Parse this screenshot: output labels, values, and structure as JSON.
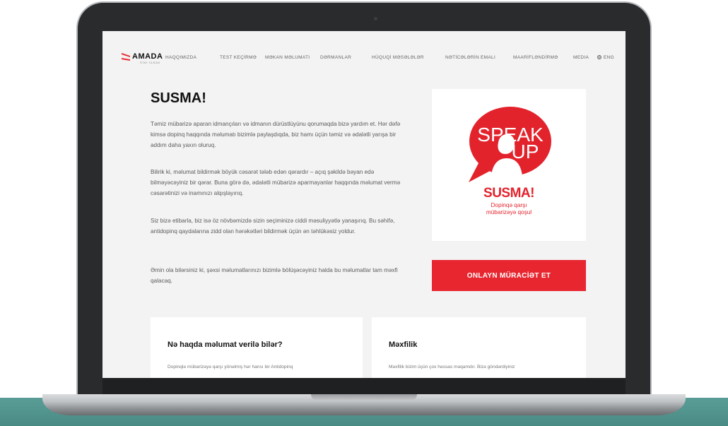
{
  "nav": {
    "logo_text": "AMADA",
    "logo_sub": "STAY CLEAN",
    "items": [
      {
        "label": "HAQQIMIZDA"
      },
      {
        "label": "TEST KEÇİRMƏ"
      },
      {
        "label": "MƏKAN MƏLUMATI"
      },
      {
        "label": "DƏRMANLAR"
      },
      {
        "label": "HÜQUQİ MƏSƏLƏLƏR"
      },
      {
        "label": "NƏTİCƏLƏRİN EMALI"
      },
      {
        "label": "MAARİFLƏNDİRMƏ"
      },
      {
        "label": "MEDIA"
      },
      {
        "label": "ENG"
      }
    ]
  },
  "hero": {
    "title": "SUSMA!",
    "paragraphs": [
      "Təmiz mübarizə aparan idmançıları və idmanın dürüstlüyünu qorumaqda bizə yardım et. Hər dəfə kimsə dopinq haqqında məlumatı bizimlə paylaşdıqda, biz hamı üçün təmiz və ədalətli yarışa bir addım daha yaxın oluruq.",
      "Bilirik ki, məlumat bildirmək böyük cəsarət tələb edən qərardır – açıq şəkildə bəyan edə bilməyəcəyiniz bir qərar. Buna görə də, ədalətli mübarizə aparmayanlar haqqında məlumat vermə cəsarətinizi və inamınızı alqışlayırıq.",
      "Siz bizə etibarla, biz isə öz növbəmizdə sizin seçiminizə ciddi məsuliyyətlə yanaşırıq. Bu səhifə, antidopinq qaydalarına zidd olan hərəkətləri bildirmək üçün ən təhlükəsiz yoldur.",
      "Əmin ola bilərsiniz ki, şəxsi məlumatlarınızı bizimlə bölüşəcəyiniz halda bu məlumatlar tam məxfi qalacaq."
    ]
  },
  "speak_card": {
    "line1": "SPEAK",
    "line2": "UP",
    "title": "SUSMA!",
    "sub1": "Dopinqə qarşı",
    "sub2": "mübarizəyə qoşul"
  },
  "cta": {
    "label": "ONLAYN MÜRACİƏT ET"
  },
  "cards": [
    {
      "title": "Nə haqda məlumat verilə bilər?",
      "text": "Dopinqlə mübarizəyə qarşı yönəlmiş hər hansı bir Antidopinq"
    },
    {
      "title": "Məxfilik",
      "text": "Məxfilik bizim üçün çox həssas məqamdır. Bizə göndərdiyiniz"
    }
  ],
  "colors": {
    "accent": "#e8262f",
    "screen_bg": "#f3f3f3",
    "bezel": "#2a2b2d",
    "band": "#4f938d"
  }
}
